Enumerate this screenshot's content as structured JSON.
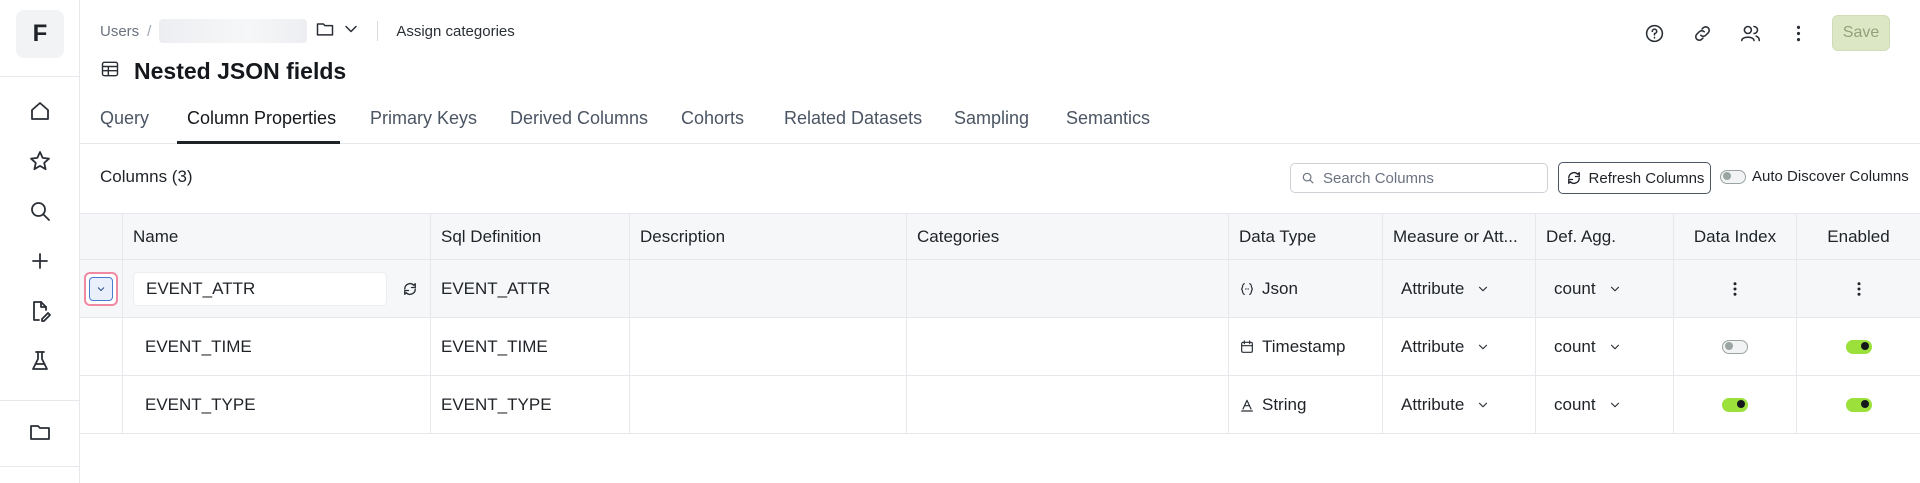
{
  "sidebar": {
    "logo": "F",
    "icons": [
      "home-icon",
      "star-icon",
      "search-icon",
      "plus-icon",
      "file-edit-icon",
      "lab-flask-icon",
      "folder-icon"
    ]
  },
  "breadcrumb": {
    "root": "Users",
    "separator": "/",
    "action": "Assign categories"
  },
  "page": {
    "title": "Nested JSON fields"
  },
  "header": {
    "save_label": "Save",
    "icons": [
      "help-icon",
      "link-icon",
      "users-icon",
      "more-vertical-icon"
    ]
  },
  "tabs": [
    {
      "label": "Query"
    },
    {
      "label": "Column Properties",
      "active": true
    },
    {
      "label": "Primary Keys"
    },
    {
      "label": "Derived Columns"
    },
    {
      "label": "Cohorts"
    },
    {
      "label": "Related Datasets"
    },
    {
      "label": "Sampling"
    },
    {
      "label": "Semantics"
    }
  ],
  "toolbar": {
    "columns_count": "Columns (3)",
    "search_placeholder": "Search Columns",
    "refresh_label": "Refresh Columns",
    "auto_discover_label": "Auto Discover Columns",
    "auto_discover_enabled": false
  },
  "table": {
    "headers": {
      "name": "Name",
      "sql": "Sql Definition",
      "description": "Description",
      "categories": "Categories",
      "data_type": "Data Type",
      "measure": "Measure or Att...",
      "agg": "Def. Agg.",
      "data_index": "Data Index",
      "enabled": "Enabled"
    },
    "rows": [
      {
        "name": "EVENT_ATTR",
        "sql": "EVENT_ATTR",
        "description": "",
        "categories": "",
        "data_type": "Json",
        "data_type_icon": "json-icon",
        "measure": "Attribute",
        "agg": "count",
        "data_index": "menu",
        "enabled": "menu"
      },
      {
        "name": "EVENT_TIME",
        "sql": "EVENT_TIME",
        "description": "",
        "categories": "",
        "data_type": "Timestamp",
        "data_type_icon": "calendar-icon",
        "measure": "Attribute",
        "agg": "count",
        "data_index": "off",
        "enabled": "on"
      },
      {
        "name": "EVENT_TYPE",
        "sql": "EVENT_TYPE",
        "description": "",
        "categories": "",
        "data_type": "String",
        "data_type_icon": "string-icon",
        "measure": "Attribute",
        "agg": "count",
        "data_index": "on",
        "enabled": "on"
      }
    ]
  },
  "colors": {
    "accent_green": "#9be03b",
    "save_disabled_bg": "#dce8c5",
    "highlight_pink": "#f08aa3"
  }
}
